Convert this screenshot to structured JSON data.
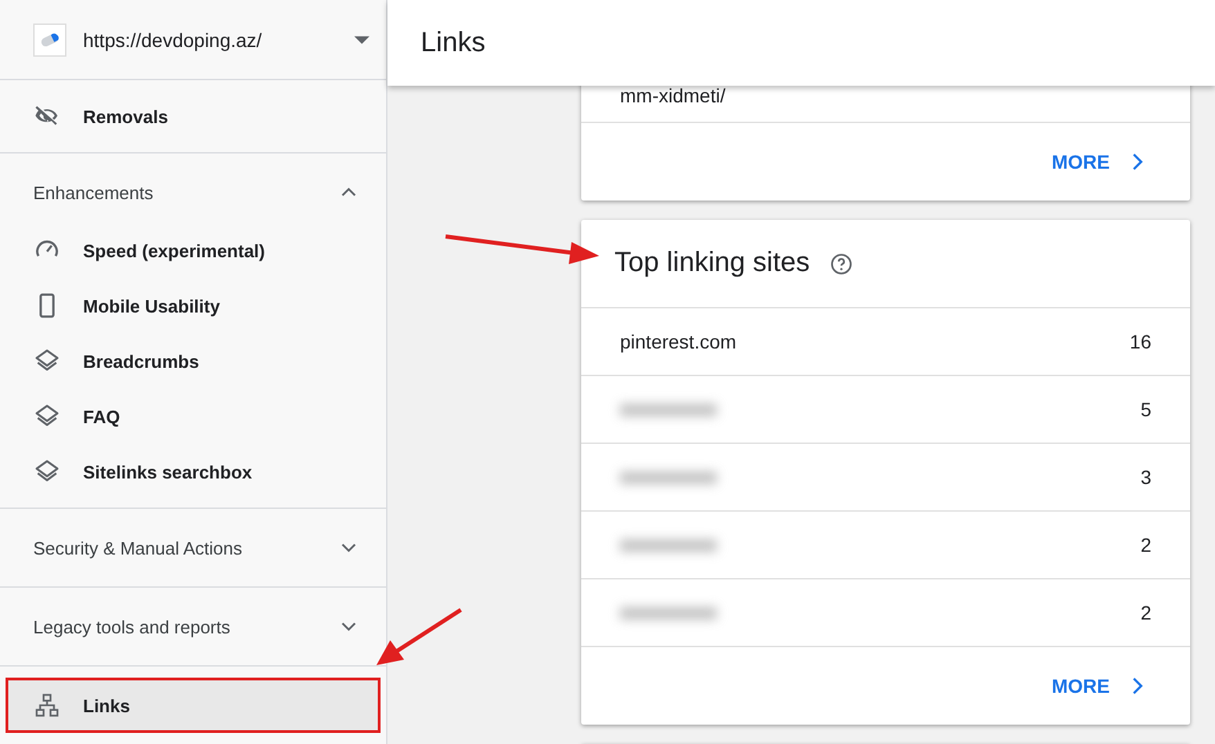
{
  "sidebar": {
    "property": {
      "url": "https://devdoping.az/"
    },
    "top_items": [
      {
        "label": "Removals",
        "kind": "eye-off",
        "selected": false
      }
    ],
    "sections": [
      {
        "title": "Enhancements",
        "expanded": true,
        "items": [
          {
            "label": "Speed (experimental)",
            "kind": "gauge",
            "selected": false
          },
          {
            "label": "Mobile Usability",
            "kind": "phone",
            "selected": false
          },
          {
            "label": "Breadcrumbs",
            "kind": "layers",
            "selected": false
          },
          {
            "label": "FAQ",
            "kind": "layers",
            "selected": false
          },
          {
            "label": "Sitelinks searchbox",
            "kind": "layers",
            "selected": false
          }
        ]
      },
      {
        "title": "Security & Manual Actions",
        "expanded": false
      },
      {
        "title": "Legacy tools and reports",
        "expanded": false
      }
    ],
    "bottom_items": [
      {
        "label": "Links",
        "kind": "sitemap",
        "selected": true,
        "annotated": true
      }
    ]
  },
  "header": {
    "title": "Links"
  },
  "cards": [
    {
      "cut_row": "mm-xidmeti/",
      "more": "MORE"
    },
    {
      "title": "Top linking sites",
      "help": true,
      "rows": [
        {
          "kind": "text",
          "site": "pinterest.com",
          "count": "16"
        },
        {
          "kind": "redacted",
          "count": "5"
        },
        {
          "kind": "redacted",
          "count": "3"
        },
        {
          "kind": "redacted",
          "count": "2"
        },
        {
          "kind": "redacted",
          "count": "2"
        }
      ],
      "more": "MORE"
    }
  ],
  "annotations": [
    {
      "kind": "arrow"
    },
    {
      "kind": "arrow"
    }
  ]
}
